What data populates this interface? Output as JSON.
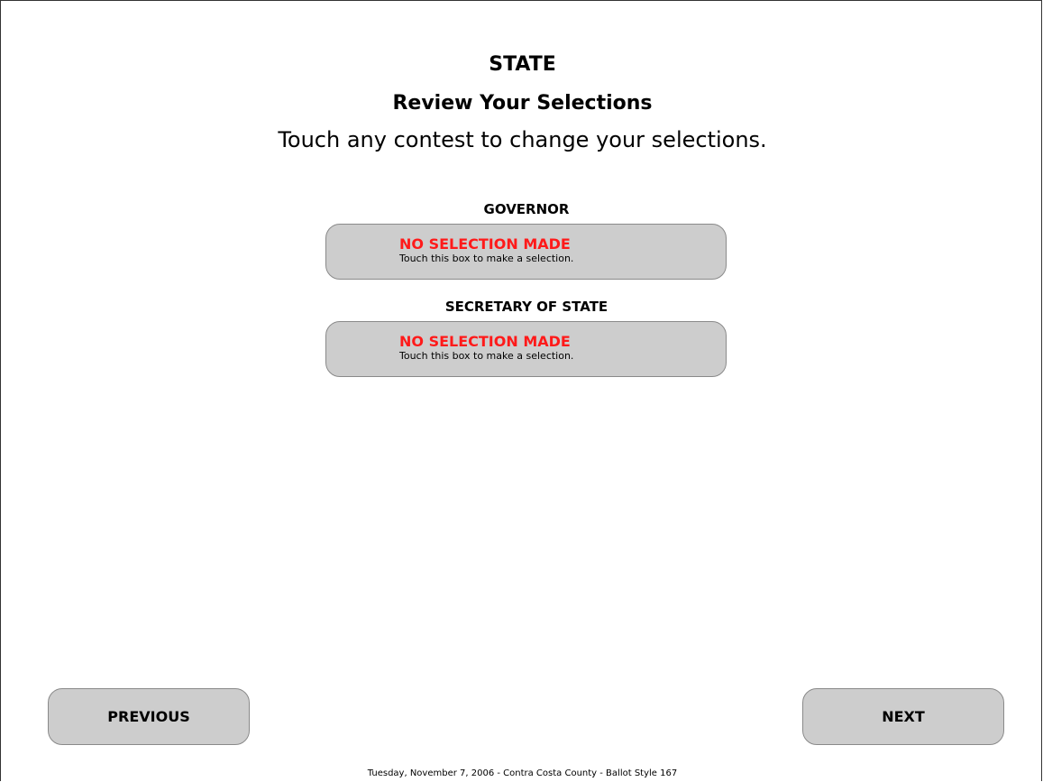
{
  "header": {
    "section": "STATE",
    "title": "Review Your Selections",
    "instructions": "Touch any contest to change your selections."
  },
  "contests": [
    {
      "title": "GOVERNOR",
      "status": "NO SELECTION MADE",
      "hint": "Touch this box to make a selection."
    },
    {
      "title": "SECRETARY OF STATE",
      "status": "NO SELECTION MADE",
      "hint": "Touch this box to make a selection."
    }
  ],
  "navigation": {
    "previous_label": "PREVIOUS",
    "next_label": "NEXT"
  },
  "footer": {
    "text": "Tuesday, November 7, 2006 - Contra Costa County - Ballot Style 167"
  },
  "colors": {
    "no_selection": "#ff1a1a",
    "button_fill": "#cdcdcd",
    "button_border": "#8a8a8a"
  }
}
